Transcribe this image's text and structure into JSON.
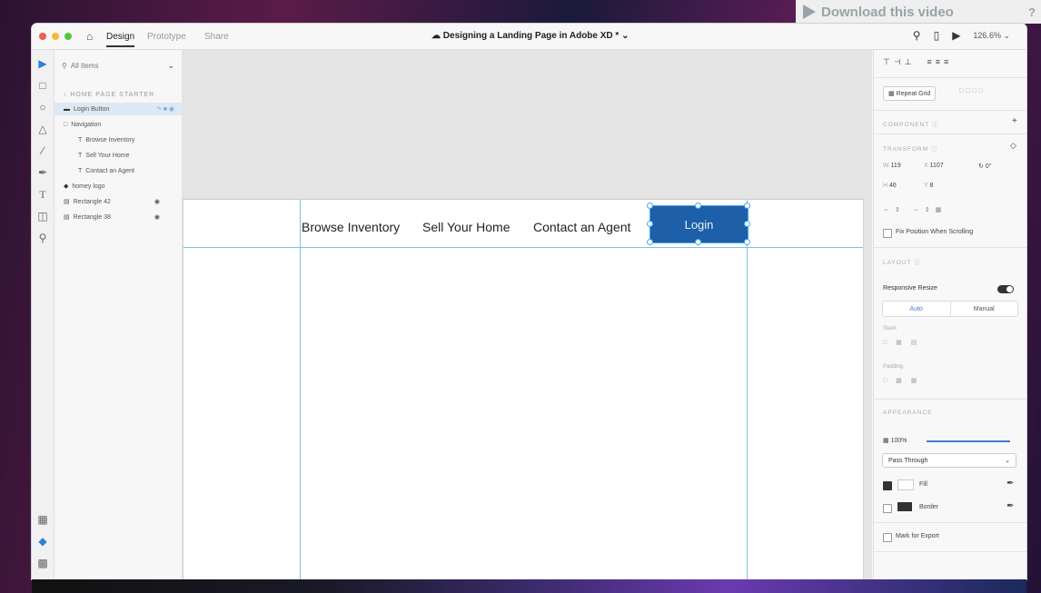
{
  "banner": {
    "label": "Download this video"
  },
  "app": {
    "tabs": {
      "design": "Design",
      "prototype": "Prototype",
      "share": "Share"
    },
    "title": "Designing a Landing Page in Adobe XD * ⌄",
    "zoom": "126.6% ⌄"
  },
  "layers": {
    "search_placeholder": "All Items",
    "section": "HOME PAGE STARTER",
    "items": [
      {
        "label": "Login Button"
      },
      {
        "label": "Navigation"
      },
      {
        "label": "Browse Inventory"
      },
      {
        "label": "Sell Your Home"
      },
      {
        "label": "Contact an Agent"
      },
      {
        "label": "homey logo"
      },
      {
        "label": "Rectangle 42"
      },
      {
        "label": "Rectangle 38"
      }
    ]
  },
  "artboard": {
    "nav_links": [
      "Browse Inventory",
      "Sell Your Home",
      "Contact an Agent"
    ],
    "login_label": "Login"
  },
  "props": {
    "repeat_grid": "Repeat Grid",
    "component": "COMPONENT",
    "transform": "TRANSFORM",
    "w_label": "W",
    "w": "119",
    "x_label": "X",
    "x": "1107",
    "rotation": "0°",
    "h_label": "H",
    "h": "46",
    "y_label": "Y",
    "y": "8",
    "fix_position": "Fix Position When Scrolling",
    "layout": "LAYOUT",
    "responsive_resize": "Responsive Resize",
    "auto": "Auto",
    "manual": "Manual",
    "stack": "Stack",
    "padding": "Padding",
    "appearance": "APPEARANCE",
    "opacity": "100%",
    "blend_mode": "Pass Through",
    "fill": "Fill",
    "border": "Border",
    "export": "Mark for Export"
  }
}
